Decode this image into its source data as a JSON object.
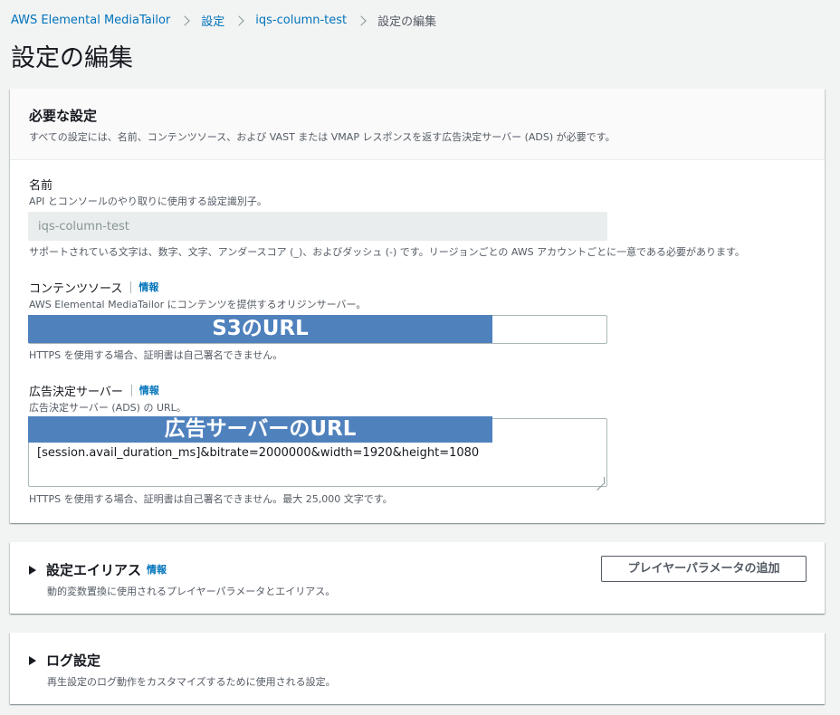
{
  "breadcrumb": {
    "items": [
      "AWS Elemental MediaTailor",
      "設定",
      "iqs-column-test"
    ],
    "current": "設定の編集"
  },
  "page": {
    "title": "設定の編集"
  },
  "required_settings": {
    "title": "必要な設定",
    "description": "すべての設定には、名前、コンテンツソース、および VAST または VMAP レスポンスを返す広告決定サーバー (ADS) が必要です。",
    "name": {
      "label": "名前",
      "description": "API とコンソールのやり取りに使用する設定識別子。",
      "value": "iqs-column-test",
      "hint": "サポートされている文字は、数字、文字、アンダースコア (_)、およびダッシュ (-) です。リージョンごとの AWS アカウントごとに一意である必要があります。"
    },
    "content_source": {
      "label": "コンテンツソース",
      "info": "情報",
      "description": "AWS Elemental MediaTailor にコンテンツを提供するオリジンサーバー。",
      "overlay": "S3のURL",
      "hint": "HTTPS を使用する場合、証明書は自己署名できません。"
    },
    "ads": {
      "label": "広告決定サーバー",
      "info": "情報",
      "description": "広告決定サーバー (ADS) の URL。",
      "overlay": "広告サーバーのURL",
      "value": "[session.avail_duration_ms]&bitrate=2000000&width=1920&height=1080",
      "hint": "HTTPS を使用する場合、証明書は自己署名できません。最大 25,000 文字です。"
    }
  },
  "aliases": {
    "title": "設定エイリアス",
    "info": "情報",
    "description": "動的変数置換に使用されるプレイヤーパラメータとエイリアス。",
    "button": "プレイヤーパラメータの追加"
  },
  "logs": {
    "title": "ログ設定",
    "description": "再生設定のログ動作をカスタマイズするために使用される設定。"
  },
  "colors": {
    "link": "#0073bb",
    "overlay": "#4f81bd",
    "background": "#f2f3f3"
  }
}
